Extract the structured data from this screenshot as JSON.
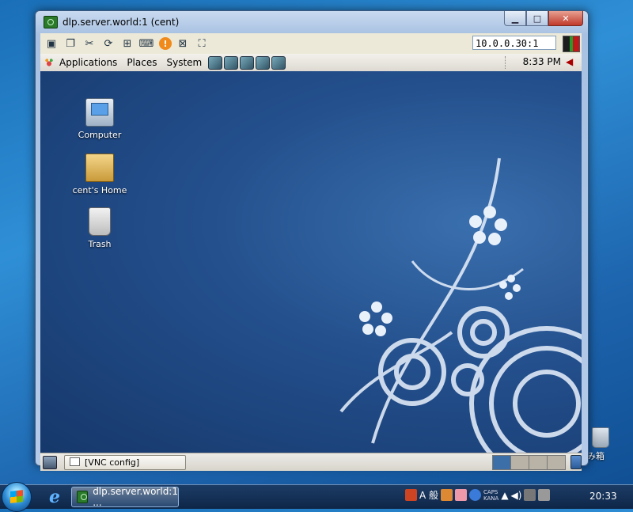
{
  "host_desktop": {
    "trash_label": "み箱"
  },
  "vnc_window": {
    "title": "dlp.server.world:1 (cent)",
    "controls": {
      "minimize": "▁",
      "maximize": "□",
      "close": "✕"
    },
    "toolbar": {
      "host_value": "10.0.0.30:1",
      "buttons": [
        "options-icon",
        "clipboard-icon",
        "tools-icon",
        "refresh-icon",
        "windows-key-icon",
        "keyboard-icon",
        "warning-icon",
        "disconnect-icon",
        "fullscreen-icon"
      ]
    }
  },
  "gnome": {
    "top_panel": {
      "menus": [
        "Applications",
        "Places",
        "System"
      ],
      "clock": "8:33 PM"
    },
    "desktop_icons": [
      {
        "label": "Computer"
      },
      {
        "label": "cent's Home"
      },
      {
        "label": "Trash"
      }
    ],
    "bottom_panel": {
      "task": "[VNC config]"
    }
  },
  "win_taskbar": {
    "task_label": "dlp.server.world:1 ...",
    "ime": "A 般",
    "caps": "CAPS",
    "kana": "KANA",
    "clock": "20:33"
  }
}
